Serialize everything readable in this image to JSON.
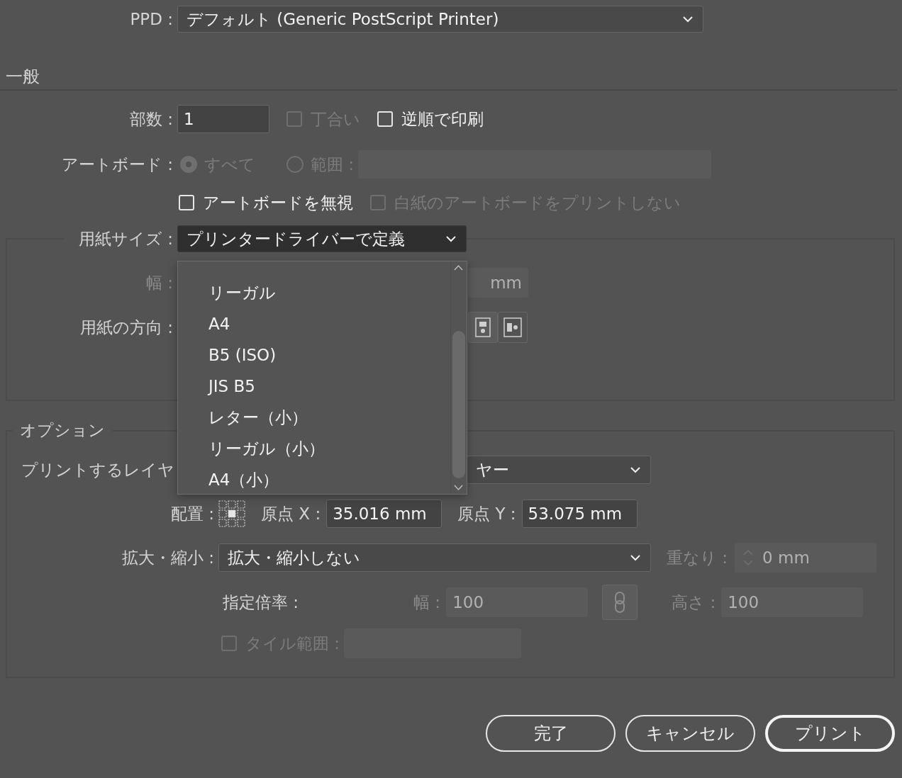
{
  "ppd": {
    "label": "PPD :",
    "value": "デフォルト (Generic PostScript Printer)"
  },
  "general": {
    "heading": "一般",
    "copies": {
      "label": "部数 :",
      "value": "1"
    },
    "collate": {
      "label": "丁合い",
      "checked": false,
      "disabled": true
    },
    "reverse": {
      "label": "逆順で印刷",
      "checked": false,
      "disabled": false
    },
    "artboards": {
      "label": "アートボード :",
      "options": [
        {
          "label": "すべて",
          "selected": true,
          "disabled": true
        },
        {
          "label": "範囲 :",
          "selected": false,
          "disabled": true
        }
      ]
    },
    "ignore_artboards": {
      "label": "アートボードを無視",
      "checked": false,
      "disabled": false
    },
    "skip_blank": {
      "label": "白紙のアートボードをプリントしない",
      "checked": false,
      "disabled": true
    },
    "paper_size": {
      "label": "用紙サイズ :",
      "value": "プリンタードライバーで定義",
      "expanded": true,
      "options": [
        {
          "label": "リーガル"
        },
        {
          "label": "A4"
        },
        {
          "label": "B5 (ISO)"
        },
        {
          "label": "JIS B5"
        },
        {
          "label": "レター（小）"
        },
        {
          "label": "リーガル（小）"
        },
        {
          "label": "A4（小）"
        }
      ]
    },
    "width": {
      "label": "幅 :",
      "unit": "mm",
      "disabled": true
    },
    "orientation": {
      "label": "用紙の方向 :"
    }
  },
  "options": {
    "heading": "オプション",
    "layers": {
      "label": "プリントするレイヤ",
      "value": "ヤー"
    },
    "placement": {
      "label": "配置 :"
    },
    "origin_x": {
      "label": "原点 X :",
      "value": "35.016 mm"
    },
    "origin_y": {
      "label": "原点 Y :",
      "value": "53.075 mm"
    },
    "scale": {
      "label": "拡大・縮小 :",
      "value": "拡大・縮小しない"
    },
    "overlap": {
      "label": "重なり :",
      "value": "0 mm",
      "disabled": true
    },
    "custom_scale": {
      "label": "指定倍率 :"
    },
    "scale_width": {
      "label": "幅 :",
      "value": "100",
      "disabled": true
    },
    "scale_height": {
      "label": "高さ :",
      "value": "100",
      "disabled": true
    },
    "tile": {
      "label": "タイル範囲 :",
      "checked": false,
      "disabled": true
    }
  },
  "buttons": [
    {
      "label": "完了",
      "kind": "normal"
    },
    {
      "label": "キャンセル",
      "kind": "normal"
    },
    {
      "label": "プリント",
      "kind": "default"
    }
  ]
}
